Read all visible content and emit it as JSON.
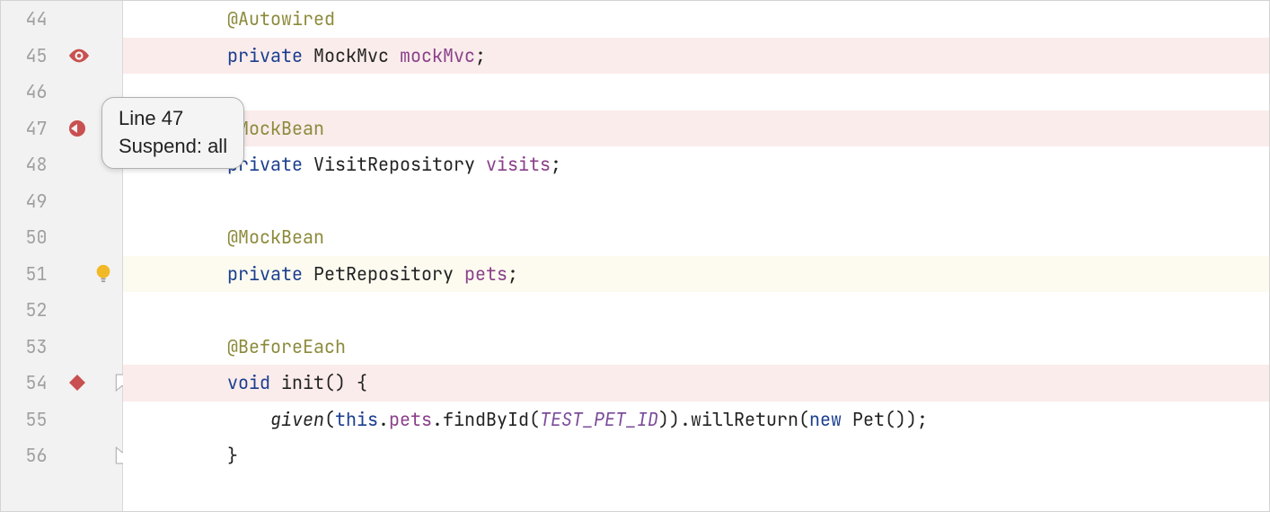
{
  "tooltip": {
    "line1": "Line 47",
    "line2": "Suspend: all"
  },
  "lines": [
    {
      "num": "44",
      "bg": "",
      "icon": null,
      "tokens": [
        {
          "text": "        ",
          "cls": ""
        },
        {
          "text": "@Autowired",
          "cls": "tok-annotation"
        }
      ]
    },
    {
      "num": "45",
      "bg": "hl-pink",
      "icon": "eye",
      "tokens": [
        {
          "text": "        ",
          "cls": ""
        },
        {
          "text": "private",
          "cls": "tok-keyword"
        },
        {
          "text": " ",
          "cls": ""
        },
        {
          "text": "MockMvc",
          "cls": "tok-type"
        },
        {
          "text": " ",
          "cls": ""
        },
        {
          "text": "mockMvc",
          "cls": "tok-field"
        },
        {
          "text": ";",
          "cls": "tok-semi"
        }
      ]
    },
    {
      "num": "46",
      "bg": "",
      "icon": null,
      "tokens": []
    },
    {
      "num": "47",
      "bg": "hl-pink",
      "icon": "breakpoint",
      "tokens": [
        {
          "text": "        ",
          "cls": ""
        },
        {
          "text": "@MockBean",
          "cls": "tok-annotation"
        }
      ]
    },
    {
      "num": "48",
      "bg": "",
      "icon": null,
      "tokens": [
        {
          "text": "        ",
          "cls": ""
        },
        {
          "text": "private",
          "cls": "tok-keyword"
        },
        {
          "text": " ",
          "cls": ""
        },
        {
          "text": "VisitRepository",
          "cls": "tok-type"
        },
        {
          "text": " ",
          "cls": ""
        },
        {
          "text": "visits",
          "cls": "tok-field"
        },
        {
          "text": ";",
          "cls": "tok-semi"
        }
      ]
    },
    {
      "num": "49",
      "bg": "",
      "icon": null,
      "tokens": []
    },
    {
      "num": "50",
      "bg": "",
      "icon": null,
      "tokens": [
        {
          "text": "        ",
          "cls": ""
        },
        {
          "text": "@MockBean",
          "cls": "tok-annotation"
        }
      ]
    },
    {
      "num": "51",
      "bg": "hl-yellow",
      "icon": "lightbulb",
      "tokens": [
        {
          "text": "        ",
          "cls": ""
        },
        {
          "text": "private",
          "cls": "tok-keyword"
        },
        {
          "text": " ",
          "cls": ""
        },
        {
          "text": "PetRepository",
          "cls": "tok-type"
        },
        {
          "text": " ",
          "cls": ""
        },
        {
          "text": "pets",
          "cls": "tok-field"
        },
        {
          "text": ";",
          "cls": "tok-semi"
        }
      ]
    },
    {
      "num": "52",
      "bg": "",
      "icon": null,
      "tokens": []
    },
    {
      "num": "53",
      "bg": "",
      "icon": null,
      "tokens": [
        {
          "text": "        ",
          "cls": ""
        },
        {
          "text": "@BeforeEach",
          "cls": "tok-annotation"
        }
      ]
    },
    {
      "num": "54",
      "bg": "hl-pink",
      "icon": "diamond",
      "fold": "start",
      "tokens": [
        {
          "text": "        ",
          "cls": ""
        },
        {
          "text": "void",
          "cls": "tok-keyword"
        },
        {
          "text": " ",
          "cls": ""
        },
        {
          "text": "init",
          "cls": "tok-method"
        },
        {
          "text": "() {",
          "cls": "tok-punct"
        }
      ]
    },
    {
      "num": "55",
      "bg": "",
      "icon": null,
      "tokens": [
        {
          "text": "            ",
          "cls": ""
        },
        {
          "text": "given",
          "cls": "tok-method-italic"
        },
        {
          "text": "(",
          "cls": "tok-punct"
        },
        {
          "text": "this",
          "cls": "tok-this"
        },
        {
          "text": ".",
          "cls": "tok-punct"
        },
        {
          "text": "pets",
          "cls": "tok-field"
        },
        {
          "text": ".",
          "cls": "tok-punct"
        },
        {
          "text": "findById",
          "cls": "tok-method"
        },
        {
          "text": "(",
          "cls": "tok-punct"
        },
        {
          "text": "TEST_PET_ID",
          "cls": "tok-const"
        },
        {
          "text": ")).",
          "cls": "tok-punct"
        },
        {
          "text": "willReturn",
          "cls": "tok-method"
        },
        {
          "text": "(",
          "cls": "tok-punct"
        },
        {
          "text": "new",
          "cls": "tok-keyword"
        },
        {
          "text": " ",
          "cls": ""
        },
        {
          "text": "Pet",
          "cls": "tok-type"
        },
        {
          "text": "());",
          "cls": "tok-punct"
        }
      ]
    },
    {
      "num": "56",
      "bg": "",
      "icon": null,
      "fold": "end",
      "tokens": [
        {
          "text": "        }",
          "cls": "tok-punct"
        }
      ]
    }
  ]
}
